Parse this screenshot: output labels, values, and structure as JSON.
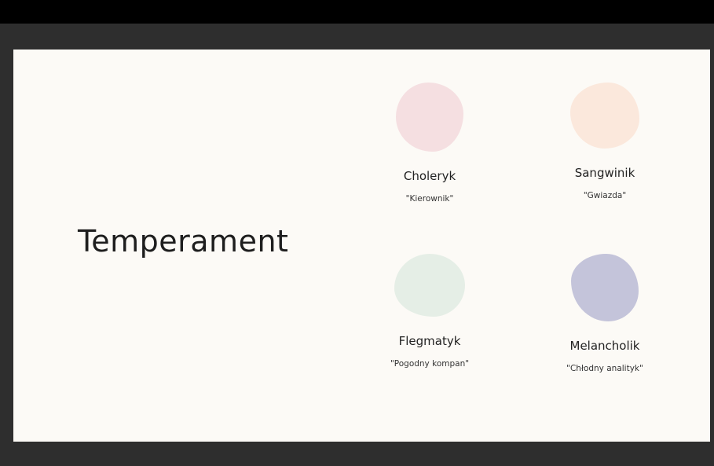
{
  "slide": {
    "title": "Temperament",
    "background": "#fcfaf6",
    "temperaments": [
      {
        "name": "Choleryk",
        "nickname": "\"Kierownik\"",
        "color": "#f5dfe1"
      },
      {
        "name": "Sangwinik",
        "nickname": "\"Gwiazda\"",
        "color": "#fbe8dc"
      },
      {
        "name": "Flegmatyk",
        "nickname": "\"Pogodny kompan\"",
        "color": "#e5eee6"
      },
      {
        "name": "Melancholik",
        "nickname": "\"Chłodny analityk\"",
        "color": "#c4c4da"
      }
    ]
  }
}
